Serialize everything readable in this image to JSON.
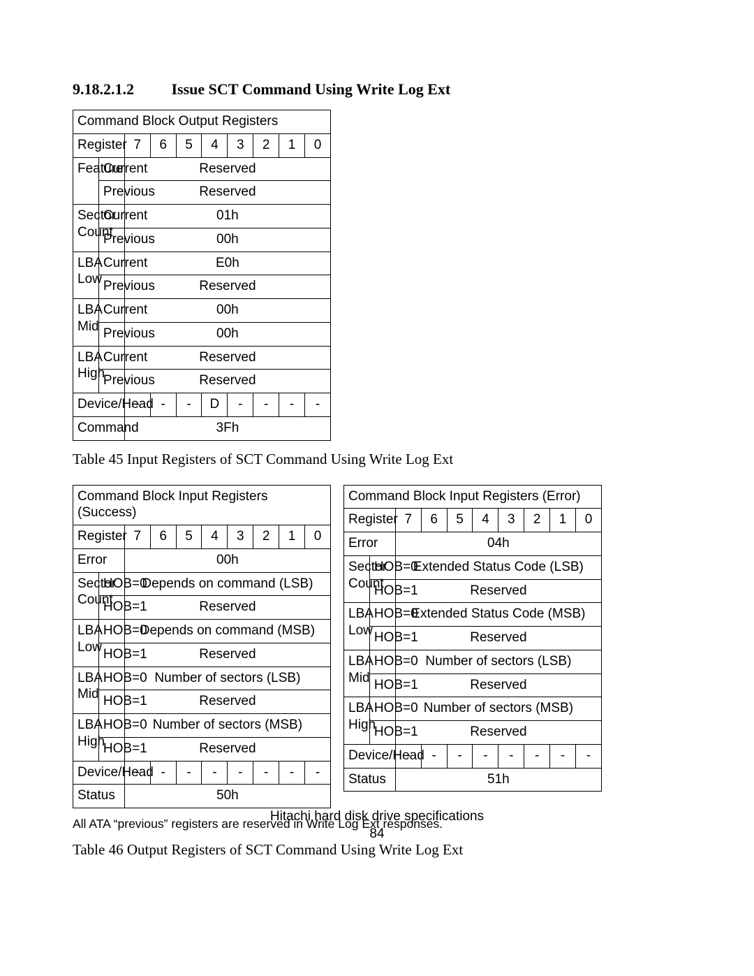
{
  "heading": {
    "number": "9.18.2.1.2",
    "title": "Issue SCT Command Using Write Log Ext"
  },
  "bits": [
    "7",
    "6",
    "5",
    "4",
    "3",
    "2",
    "1",
    "0"
  ],
  "regLabel": "Register",
  "table45": {
    "title": "Command Block Output Registers",
    "rows": [
      {
        "name": "Feature",
        "sub1": "Current",
        "val1": "Reserved",
        "sub2": "Previous",
        "val2": "Reserved"
      },
      {
        "name": "Sector Count",
        "sub1": "Current",
        "val1": "01h",
        "sub2": "Previous",
        "val2": "00h"
      },
      {
        "name": "LBA Low",
        "sub1": "Current",
        "val1": "E0h",
        "sub2": "Previous",
        "val2": "Reserved"
      },
      {
        "name": "LBA Mid",
        "sub1": "Current",
        "val1": "00h",
        "sub2": "Previous",
        "val2": "00h"
      },
      {
        "name": "LBA High",
        "sub1": "Current",
        "val1": "Reserved",
        "sub2": "Previous",
        "val2": "Reserved"
      }
    ],
    "deviceHead": {
      "name": "Device/Head",
      "bits": [
        "-",
        "-",
        "-",
        "D",
        "-",
        "-",
        "-",
        "-"
      ]
    },
    "command": {
      "name": "Command",
      "value": "3Fh"
    },
    "caption": "Table 45    Input Registers of SCT Command Using Write Log Ext"
  },
  "table46": {
    "success": {
      "title": "Command Block Input Registers (Success)",
      "error": {
        "name": "Error",
        "value": "00h"
      },
      "rows": [
        {
          "name": "Sector Count",
          "sub1": "HOB=0",
          "val1": "Depends on command (LSB)",
          "sub2": "HOB=1",
          "val2": "Reserved"
        },
        {
          "name": "LBA Low",
          "sub1": "HOB=0",
          "val1": "Depends on command (MSB)",
          "sub2": "HOB=1",
          "val2": "Reserved"
        },
        {
          "name": "LBA Mid",
          "sub1": "HOB=0",
          "val1": "Number of sectors (LSB)",
          "sub2": "HOB=1",
          "val2": "Reserved"
        },
        {
          "name": "LBA High",
          "sub1": "HOB=0",
          "val1": "Number of sectors (MSB)",
          "sub2": "HOB=1",
          "val2": "Reserved"
        }
      ],
      "deviceHead": {
        "name": "Device/Head",
        "bits": [
          "-",
          "-",
          "-",
          "-",
          "-",
          "-",
          "-",
          "-"
        ]
      },
      "status": {
        "name": "Status",
        "value": "50h"
      }
    },
    "error": {
      "title": "Command Block Input Registers (Error)",
      "error": {
        "name": "Error",
        "value": "04h"
      },
      "rows": [
        {
          "name": "Sector Count",
          "sub1": "HOB=0",
          "val1": "Extended Status Code (LSB)",
          "sub2": "HOB=1",
          "val2": "Reserved"
        },
        {
          "name": "LBA Low",
          "sub1": "HOB=0",
          "val1": "Extended Status Code (MSB)",
          "sub2": "HOB=1",
          "val2": "Reserved"
        },
        {
          "name": "LBA Mid",
          "sub1": "HOB=0",
          "val1": "Number of sectors (LSB)",
          "sub2": "HOB=1",
          "val2": "Reserved"
        },
        {
          "name": "LBA High",
          "sub1": "HOB=0",
          "val1": "Number of sectors (MSB)",
          "sub2": "HOB=1",
          "val2": "Reserved"
        }
      ],
      "deviceHead": {
        "name": "Device/Head",
        "bits": [
          "-",
          "-",
          "-",
          "-",
          "-",
          "-",
          "-",
          "-"
        ]
      },
      "status": {
        "name": "Status",
        "value": "51h"
      }
    },
    "note": "All ATA “previous” registers are reserved in Write Log Ext responses.",
    "caption": "Table 46    Output Registers of SCT Command Using Write Log Ext"
  },
  "footer": {
    "line1": "Hitachi hard disk drive specifications",
    "line2": "84"
  },
  "chart_data": [
    {
      "type": "table",
      "title": "Command Block Output Registers",
      "columns": [
        "Register",
        "",
        "7",
        "6",
        "5",
        "4",
        "3",
        "2",
        "1",
        "0"
      ],
      "rows": [
        [
          "Feature",
          "Current",
          "Reserved"
        ],
        [
          "Feature",
          "Previous",
          "Reserved"
        ],
        [
          "Sector Count",
          "Current",
          "01h"
        ],
        [
          "Sector Count",
          "Previous",
          "00h"
        ],
        [
          "LBA Low",
          "Current",
          "E0h"
        ],
        [
          "LBA Low",
          "Previous",
          "Reserved"
        ],
        [
          "LBA Mid",
          "Current",
          "00h"
        ],
        [
          "LBA Mid",
          "Previous",
          "00h"
        ],
        [
          "LBA High",
          "Current",
          "Reserved"
        ],
        [
          "LBA High",
          "Previous",
          "Reserved"
        ],
        [
          "Device/Head",
          "",
          "-",
          "-",
          "-",
          "D",
          "-",
          "-",
          "-",
          "-"
        ],
        [
          "Command",
          "",
          "3Fh"
        ]
      ]
    },
    {
      "type": "table",
      "title": "Command Block Input Registers (Success)",
      "columns": [
        "Register",
        "",
        "7",
        "6",
        "5",
        "4",
        "3",
        "2",
        "1",
        "0"
      ],
      "rows": [
        [
          "Error",
          "",
          "00h"
        ],
        [
          "Sector Count",
          "HOB=0",
          "Depends on command (LSB)"
        ],
        [
          "Sector Count",
          "HOB=1",
          "Reserved"
        ],
        [
          "LBA Low",
          "HOB=0",
          "Depends on command (MSB)"
        ],
        [
          "LBA Low",
          "HOB=1",
          "Reserved"
        ],
        [
          "LBA Mid",
          "HOB=0",
          "Number of sectors (LSB)"
        ],
        [
          "LBA Mid",
          "HOB=1",
          "Reserved"
        ],
        [
          "LBA High",
          "HOB=0",
          "Number of sectors (MSB)"
        ],
        [
          "LBA High",
          "HOB=1",
          "Reserved"
        ],
        [
          "Device/Head",
          "",
          "-",
          "-",
          "-",
          "-",
          "-",
          "-",
          "-",
          "-"
        ],
        [
          "Status",
          "",
          "50h"
        ]
      ]
    },
    {
      "type": "table",
      "title": "Command Block Input Registers (Error)",
      "columns": [
        "Register",
        "",
        "7",
        "6",
        "5",
        "4",
        "3",
        "2",
        "1",
        "0"
      ],
      "rows": [
        [
          "Error",
          "",
          "04h"
        ],
        [
          "Sector Count",
          "HOB=0",
          "Extended Status Code (LSB)"
        ],
        [
          "Sector Count",
          "HOB=1",
          "Reserved"
        ],
        [
          "LBA Low",
          "HOB=0",
          "Extended Status Code (MSB)"
        ],
        [
          "LBA Low",
          "HOB=1",
          "Reserved"
        ],
        [
          "LBA Mid",
          "HOB=0",
          "Number of sectors (LSB)"
        ],
        [
          "LBA Mid",
          "HOB=1",
          "Reserved"
        ],
        [
          "LBA High",
          "HOB=0",
          "Number of sectors (MSB)"
        ],
        [
          "LBA High",
          "HOB=1",
          "Reserved"
        ],
        [
          "Device/Head",
          "",
          "-",
          "-",
          "-",
          "-",
          "-",
          "-",
          "-",
          "-"
        ],
        [
          "Status",
          "",
          "51h"
        ]
      ]
    }
  ]
}
